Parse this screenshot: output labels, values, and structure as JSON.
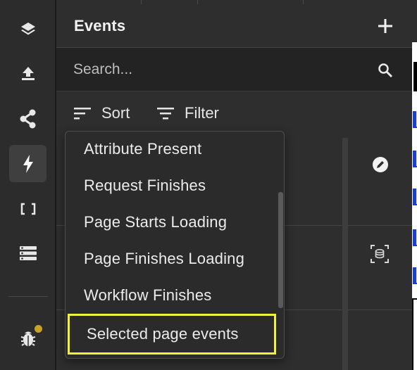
{
  "panel": {
    "title": "Events",
    "search_placeholder": "Search...",
    "sort_label": "Sort",
    "filter_label": "Filter"
  },
  "sidebar": {
    "items": [
      {
        "icon": "layers-icon",
        "active": false
      },
      {
        "icon": "upload-icon",
        "active": false
      },
      {
        "icon": "share-nodes-icon",
        "active": false
      },
      {
        "icon": "lightning-icon",
        "active": true
      },
      {
        "icon": "brackets-icon",
        "active": false
      },
      {
        "icon": "list-rows-icon",
        "active": false
      },
      {
        "icon": "bug-icon",
        "active": false
      }
    ]
  },
  "dropdown": {
    "items": [
      "Attribute Present",
      "Request Finishes",
      "Page Starts Loading",
      "Page Finishes Loading",
      "Workflow Finishes"
    ],
    "highlighted": "Selected page events"
  },
  "colors": {
    "rail_bg": "#2c2c2c",
    "panel_bg": "#2e2e2e",
    "search_bg": "#232323",
    "highlight": "#f2f23a",
    "badge": "#c9a227"
  }
}
